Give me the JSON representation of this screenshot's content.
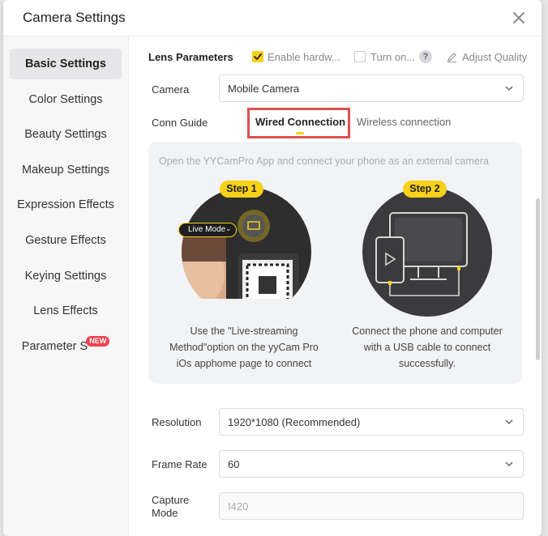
{
  "window": {
    "title": "Camera Settings"
  },
  "sidebar": {
    "items": [
      {
        "label": "Basic Settings",
        "active": true
      },
      {
        "label": "Color Settings"
      },
      {
        "label": "Beauty Settings"
      },
      {
        "label": "Makeup Settings"
      },
      {
        "label": "Expression Effects"
      },
      {
        "label": "Gesture Effects"
      },
      {
        "label": "Keying Settings"
      },
      {
        "label": "Lens Effects"
      },
      {
        "label": "Parameter S",
        "badge": "NEW"
      }
    ]
  },
  "lens": {
    "title": "Lens Parameters",
    "hw_label": "Enable hardw...",
    "hw_checked": true,
    "turn_label": "Turn on...",
    "turn_checked": false,
    "help": "?",
    "adjust_label": "Adjust Quality"
  },
  "camera": {
    "label": "Camera",
    "value": "Mobile Camera"
  },
  "conn": {
    "label": "Conn Guide",
    "tab_wired": "Wired Connection",
    "tab_wireless": "Wireless connection",
    "hint": "Open the YYCamPro App and connect your phone as an external camera",
    "step1": {
      "badge": "Step 1",
      "mode_label": "Live Mode",
      "caption_line1": "Use the \"Live-streaming",
      "caption_line2": "Method\"option on the yyCam Pro",
      "caption_line3": "iOs apphome page to connect"
    },
    "step2": {
      "badge": "Step 2",
      "caption_line1": "Connect the phone and computer",
      "caption_line2": "with a USB cable to connect",
      "caption_line3": "successfully."
    }
  },
  "resolution": {
    "label": "Resolution",
    "value": "1920*1080 (Recommended)"
  },
  "frame_rate": {
    "label": "Frame Rate",
    "value": "60"
  },
  "capture": {
    "label_line1": "Capture",
    "label_line2": "Mode",
    "placeholder": "I420"
  },
  "colors": {
    "accent": "#f7d117",
    "highlight_border": "#e05050"
  }
}
